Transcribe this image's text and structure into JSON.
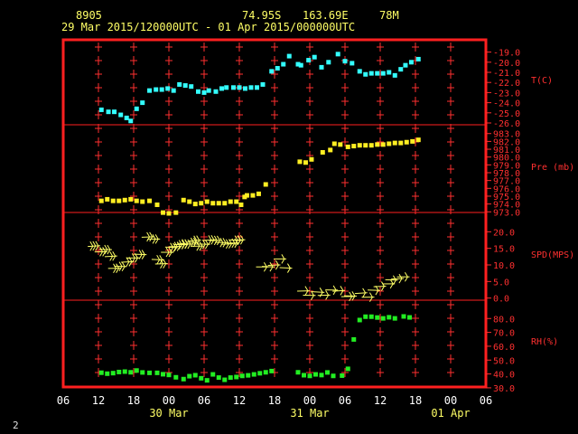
{
  "header": {
    "station": "8905",
    "lat": "74.95S",
    "lon": "163.69E",
    "elev": "78M",
    "period": "29 Mar 2015/120000UTC - 01 Apr 2015/000000UTC"
  },
  "corner_label": "2",
  "colors": {
    "frame": "#ff2020",
    "axis_text": "#ff3030",
    "header_text": "#ffff66",
    "date_text": "#ffff66",
    "temperature": "#33ffff",
    "pressure": "#ffee22",
    "wind": "#ffff66",
    "rh": "#22ee22",
    "grid_marks": "#ff3030"
  },
  "chart_data": {
    "type": "scatter",
    "x_axis": {
      "units": "hours since 29 Mar 2015 06UTC",
      "range": [
        0,
        72
      ],
      "tick_labels": [
        "06",
        "12",
        "18",
        "00",
        "06",
        "12",
        "18",
        "00",
        "06",
        "12",
        "18",
        "00",
        "06"
      ],
      "date_labels": [
        {
          "text": "30 Mar",
          "at_hour": 18
        },
        {
          "text": "31 Mar",
          "at_hour": 42
        },
        {
          "text": "01 Apr",
          "at_hour": 66
        }
      ]
    },
    "panels": [
      {
        "id": "temperature",
        "label": "T(C)",
        "style": "square",
        "range": [
          -26,
          -18.5
        ],
        "ticks": [
          -19,
          -20,
          -21,
          -22,
          -23,
          -24,
          -25,
          -26
        ],
        "tick_labels": [
          "-19.0",
          "-20.0",
          "-21.0",
          "-22.0",
          "-23.0",
          "-24.0",
          "-25.0",
          "-26.0"
        ],
        "x": [
          6.5,
          7.7,
          8.7,
          9.8,
          10.8,
          11.5,
          12.5,
          13.5,
          14.7,
          15.8,
          16.8,
          17.8,
          18.8,
          19.8,
          20.8,
          21.8,
          23,
          24,
          24.8,
          26,
          27,
          27.8,
          29,
          30,
          31,
          32,
          33,
          34,
          35.5,
          36.5,
          37.5,
          38.5,
          40,
          40.5,
          41.8,
          42.8,
          44,
          45.2,
          46.8,
          48,
          49.2,
          50.5,
          51.5,
          52.5,
          53.5,
          54.5,
          55.5,
          56.5,
          57.5,
          58.3,
          59.3,
          60.5
        ],
        "y": [
          -24.7,
          -24.9,
          -24.9,
          -25.2,
          -25.5,
          -25.8,
          -24.6,
          -24.0,
          -22.8,
          -22.7,
          -22.7,
          -22.6,
          -22.8,
          -22.2,
          -22.3,
          -22.4,
          -22.9,
          -23.0,
          -22.8,
          -22.9,
          -22.6,
          -22.5,
          -22.5,
          -22.5,
          -22.6,
          -22.5,
          -22.5,
          -22.2,
          -20.9,
          -20.6,
          -20.2,
          -19.4,
          -20.2,
          -20.3,
          -19.8,
          -19.5,
          -20.5,
          -20.0,
          -19.2,
          -19.9,
          -20.1,
          -20.9,
          -21.2,
          -21.1,
          -21.1,
          -21.1,
          -21.0,
          -21.3,
          -20.7,
          -20.3,
          -20.0,
          -19.7
        ]
      },
      {
        "id": "pressure",
        "label": "Pre (mb)",
        "style": "square",
        "range": [
          972.8,
          983.2
        ],
        "ticks": [
          973,
          974,
          975,
          976,
          977,
          978,
          979,
          980,
          981,
          982,
          983
        ],
        "tick_labels": [
          "973.0",
          "974.0",
          "975.0",
          "976.0",
          "977.0",
          "978.0",
          "979.0",
          "980.0",
          "981.0",
          "982.0",
          "983.0"
        ],
        "x": [
          6.5,
          7.5,
          8.5,
          9.5,
          10.5,
          11.5,
          12.5,
          13.5,
          14.7,
          16,
          17,
          18,
          19.2,
          20.5,
          21.5,
          22.5,
          23.5,
          24.5,
          25.5,
          26.5,
          27.5,
          28.5,
          29.5,
          30.3,
          30.9,
          31.3,
          32.3,
          33.3,
          34.5,
          40.3,
          41.3,
          42.3,
          44.2,
          45.5,
          46.2,
          47.2,
          48.5,
          49.5,
          50.5,
          51.5,
          52.5,
          53.5,
          54.5,
          55.5,
          56.5,
          57.5,
          58.5,
          59.5,
          60.5
        ],
        "y": [
          974.4,
          974.6,
          974.4,
          974.4,
          974.5,
          974.6,
          974.4,
          974.3,
          974.4,
          973.9,
          972.9,
          972.8,
          972.9,
          974.5,
          974.3,
          974.0,
          974.1,
          974.3,
          974.1,
          974.1,
          974.1,
          974.3,
          974.3,
          973.9,
          974.9,
          975.1,
          975.1,
          975.3,
          976.5,
          979.4,
          979.3,
          979.7,
          980.6,
          980.9,
          981.7,
          981.6,
          981.3,
          981.4,
          981.5,
          981.5,
          981.5,
          981.6,
          981.6,
          981.7,
          981.8,
          981.8,
          981.9,
          982.0,
          982.2
        ]
      },
      {
        "id": "wind",
        "label": "SPD(MPS)",
        "style": "barb",
        "range": [
          -2,
          22
        ],
        "ticks": [
          20,
          15,
          10,
          5,
          0
        ],
        "tick_labels": [
          "20.0",
          "15.0",
          "10.0",
          "5.0",
          "0.0"
        ],
        "x": [
          6.3,
          7.5,
          8.3,
          9.2,
          9.8,
          10.8,
          12,
          13,
          14.2,
          15.5,
          16.5,
          17.2,
          17.8,
          18.8,
          19.5,
          20.2,
          21,
          21.5,
          22,
          23,
          23.5,
          24,
          25,
          26,
          27,
          28,
          29,
          30,
          30.5,
          31,
          35,
          36,
          37,
          38,
          39,
          42,
          43,
          44.5,
          45.5,
          46.8,
          48,
          49.5,
          50,
          51.8,
          53,
          54,
          55,
          56.5,
          57,
          58,
          59
        ],
        "y": [
          15.8,
          14,
          14.6,
          12.7,
          9,
          9.5,
          11,
          12.1,
          13.1,
          18.5,
          17.8,
          11.5,
          10.4,
          13.8,
          15.2,
          15.6,
          16.1,
          16.3,
          16.3,
          16.8,
          17.5,
          15.7,
          16.2,
          17.6,
          17.4,
          16.7,
          16.4,
          16.6,
          17.4,
          17.6,
          9.4,
          9.4,
          10,
          11.8,
          9,
          2.2,
          0.8,
          1.7,
          0.9,
          2.4,
          2.3,
          0.5,
          0.6,
          1.6,
          0.3,
          2.3,
          3.6,
          4.3,
          5.4,
          5.9,
          6.4
        ],
        "barbs": [
          3,
          2,
          2,
          2,
          2,
          2,
          2,
          2,
          2,
          2,
          2,
          2,
          2,
          2,
          2,
          2,
          2,
          2,
          2,
          2,
          2,
          2,
          2,
          2,
          2,
          2,
          2,
          2,
          2,
          2,
          1,
          1,
          1,
          1,
          1,
          1,
          1,
          1,
          1,
          1,
          1,
          1,
          1,
          1,
          1,
          1,
          1,
          1,
          1,
          1,
          1
        ]
      },
      {
        "id": "rh",
        "label": "RH(%)",
        "style": "square",
        "range": [
          28,
          88
        ],
        "ticks": [
          80,
          70,
          60,
          50,
          40,
          30
        ],
        "tick_labels": [
          "80.0",
          "70.0",
          "60.0",
          "50.0",
          "40.0",
          "30.0"
        ],
        "x": [
          6.5,
          7.5,
          8.5,
          9.5,
          10.5,
          11.5,
          12.5,
          13.5,
          14.7,
          16,
          17,
          18,
          19.2,
          20.5,
          21.5,
          22.5,
          23.5,
          24.5,
          25.5,
          26.5,
          27.5,
          28.5,
          29.5,
          30.5,
          31.5,
          32.5,
          33.5,
          34.5,
          35.5,
          40,
          41,
          42,
          43,
          44,
          45,
          46,
          47.5,
          48.5,
          49.5,
          50.5,
          51.5,
          52.5,
          53.5,
          54.5,
          55.5,
          56.5,
          58,
          59
        ],
        "y": [
          40.9,
          40.2,
          40.6,
          41.4,
          41.7,
          41.2,
          42.5,
          41.1,
          40.8,
          40.8,
          39.8,
          39.3,
          37.6,
          36.3,
          38.4,
          39.1,
          36.9,
          35.4,
          39.7,
          37.4,
          35.8,
          37.4,
          37.8,
          38.6,
          39.0,
          39.7,
          40.5,
          41.2,
          42.1,
          41.2,
          39.1,
          38.6,
          39.7,
          39.2,
          41.1,
          38.6,
          38.8,
          43.7,
          64.9,
          78.9,
          81.3,
          81.3,
          80.7,
          80.1,
          80.9,
          80.1,
          81.5,
          80.8
        ]
      }
    ]
  }
}
